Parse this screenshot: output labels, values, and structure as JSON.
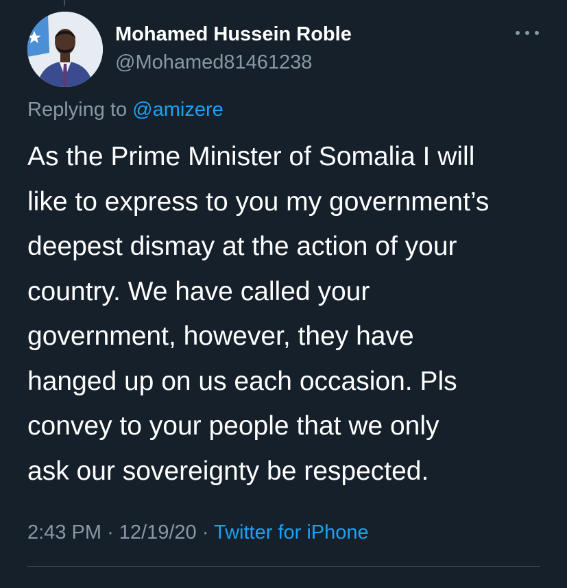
{
  "tweet": {
    "author_name": "Mohamed Hussein Roble",
    "author_handle": "@Mohamed81461238",
    "replying_prefix": "Replying to ",
    "replying_handle": "@amizere",
    "text_lines": [
      "As the Prime Minister of Somalia I will",
      "like to express to you my government’s",
      "deepest dismay at the action of your",
      "country. We have called your",
      "government, however, they have",
      "hanged up on us each occasion. Pls",
      "convey to your people that we only",
      "ask our sovereignty be respected."
    ],
    "time": "2:43 PM",
    "date": "12/19/20",
    "separator": "·",
    "source": "Twitter for iPhone"
  },
  "icons": {
    "more": "more-options-icon",
    "avatar": "profile-avatar"
  },
  "colors": {
    "background": "#15202b",
    "text_primary": "#ffffff",
    "text_secondary": "#8899a6",
    "accent": "#1da1f2",
    "divider": "#38444d"
  }
}
